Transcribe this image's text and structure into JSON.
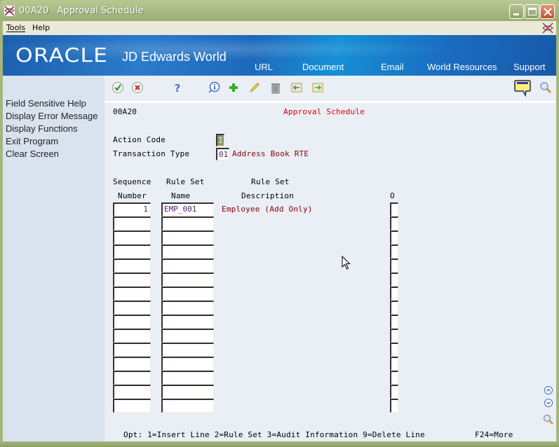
{
  "window": {
    "program_code": "00A20",
    "title": "Approval Schedule",
    "controls": {
      "minimize": "minimize",
      "maximize": "maximize",
      "close": "close"
    }
  },
  "menubar": {
    "items": [
      {
        "label": "Tools",
        "accel": "T"
      },
      {
        "label": "Help",
        "accel": "H"
      }
    ]
  },
  "banner": {
    "logo": "ORACLE",
    "product": "JD Edwards World",
    "links": [
      "URL",
      "Document",
      "Email",
      "World Resources",
      "Support"
    ]
  },
  "sidebar": {
    "items": [
      {
        "label": "Field Sensitive Help"
      },
      {
        "label": "Display Error Message"
      },
      {
        "label": "Display Functions"
      },
      {
        "label": "Exit Program"
      },
      {
        "label": "Clear Screen"
      }
    ]
  },
  "toolbar": {
    "icons": [
      "ok-check-icon",
      "cancel-x-icon",
      "help-question-icon",
      "info-icon",
      "add-plus-icon",
      "edit-pencil-icon",
      "delete-trash-icon",
      "previous-record-icon",
      "next-record-icon"
    ],
    "right_icons": [
      "message-bubble-icon",
      "search-magnifier-icon"
    ]
  },
  "form": {
    "program_code": "00A20",
    "title": "Approval Schedule",
    "action_code_label": "Action Code",
    "action_code_value": "I",
    "transaction_type_label": "Transaction Type",
    "transaction_type_value": "01",
    "transaction_type_desc": "Address Book RTE",
    "columns": {
      "seq_line1": "Sequence",
      "seq_line2": "Number",
      "ruleset_line1": "Rule Set",
      "ruleset_line2": "Name",
      "desc_line1": "Rule Set",
      "desc_line2": "Description",
      "opt": "O"
    },
    "rows": [
      {
        "seq": "1",
        "rule_set": "EMP_001",
        "description": "Employee (Add Only)",
        "opt": ""
      },
      {
        "seq": "",
        "rule_set": "",
        "description": "",
        "opt": ""
      },
      {
        "seq": "",
        "rule_set": "",
        "description": "",
        "opt": ""
      },
      {
        "seq": "",
        "rule_set": "",
        "description": "",
        "opt": ""
      },
      {
        "seq": "",
        "rule_set": "",
        "description": "",
        "opt": ""
      },
      {
        "seq": "",
        "rule_set": "",
        "description": "",
        "opt": ""
      },
      {
        "seq": "",
        "rule_set": "",
        "description": "",
        "opt": ""
      },
      {
        "seq": "",
        "rule_set": "",
        "description": "",
        "opt": ""
      },
      {
        "seq": "",
        "rule_set": "",
        "description": "",
        "opt": ""
      },
      {
        "seq": "",
        "rule_set": "",
        "description": "",
        "opt": ""
      },
      {
        "seq": "",
        "rule_set": "",
        "description": "",
        "opt": ""
      },
      {
        "seq": "",
        "rule_set": "",
        "description": "",
        "opt": ""
      },
      {
        "seq": "",
        "rule_set": "",
        "description": "",
        "opt": ""
      },
      {
        "seq": "",
        "rule_set": "",
        "description": "",
        "opt": ""
      },
      {
        "seq": "",
        "rule_set": "",
        "description": "",
        "opt": ""
      }
    ],
    "footer_options": "Opt: 1=Insert Line 2=Rule Set 3=Audit Information 9=Delete Line",
    "footer_more": "F24=More"
  },
  "colors": {
    "title_red": "#e00000",
    "desc_maroon": "#8a0000",
    "field_text": "#5a1a6a",
    "banner_blue": "#1e69bb",
    "sidebar_bg": "#d9e3ef",
    "main_bg": "#eaeef5",
    "frame_green": "#a4b67c"
  }
}
